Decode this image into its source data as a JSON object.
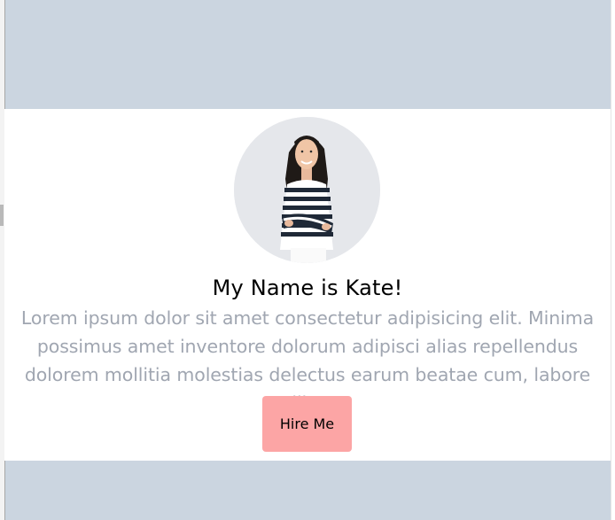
{
  "profile": {
    "name_heading": "My Name is Kate!",
    "description": "Lorem ipsum dolor sit amet consectetur adipisicing elit. Minima possimus amet inventore dolorum adipisci alias repellendus dolorem mollitia molestias delectus earum beatae cum, labore illo.",
    "cta_label": "Hire Me"
  },
  "colors": {
    "page_background": "#cbd5e0",
    "card_background": "#ffffff",
    "avatar_background": "#e5e7eb",
    "description_text": "#a0a6b1",
    "button_background": "#fca5a5"
  },
  "icons": {
    "avatar": "profile-photo"
  }
}
